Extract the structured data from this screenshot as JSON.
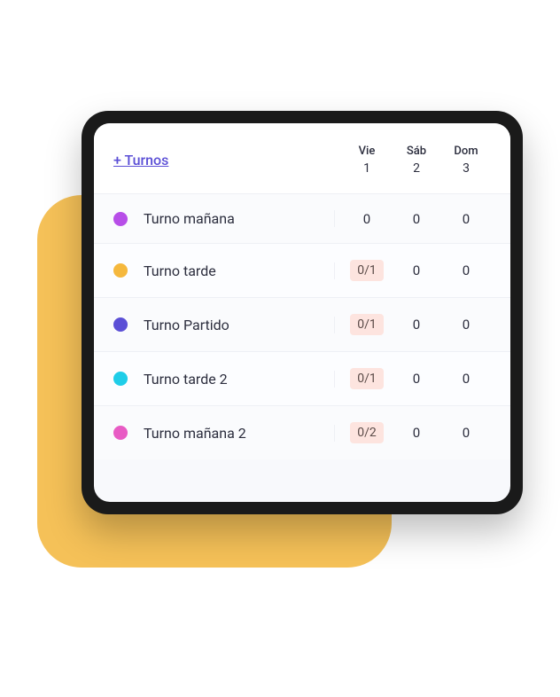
{
  "header": {
    "add_label": "+ Turnos",
    "days": [
      {
        "name": "Vie",
        "num": "1"
      },
      {
        "name": "Sáb",
        "num": "2"
      },
      {
        "name": "Dom",
        "num": "3"
      }
    ]
  },
  "shifts": [
    {
      "color": "#b74ee8",
      "name": "Turno mañana",
      "cells": [
        {
          "value": "0",
          "highlight": false
        },
        {
          "value": "0",
          "highlight": false
        },
        {
          "value": "0",
          "highlight": false
        }
      ]
    },
    {
      "color": "#f5b83d",
      "name": "Turno tarde",
      "cells": [
        {
          "value": "0/1",
          "highlight": true
        },
        {
          "value": "0",
          "highlight": false
        },
        {
          "value": "0",
          "highlight": false
        }
      ]
    },
    {
      "color": "#5b4fd6",
      "name": "Turno Partido",
      "cells": [
        {
          "value": "0/1",
          "highlight": true
        },
        {
          "value": "0",
          "highlight": false
        },
        {
          "value": "0",
          "highlight": false
        }
      ]
    },
    {
      "color": "#1fcde8",
      "name": "Turno tarde 2",
      "cells": [
        {
          "value": "0/1",
          "highlight": true
        },
        {
          "value": "0",
          "highlight": false
        },
        {
          "value": "0",
          "highlight": false
        }
      ]
    },
    {
      "color": "#e85bc4",
      "name": "Turno mañana 2",
      "cells": [
        {
          "value": "0/2",
          "highlight": true
        },
        {
          "value": "0",
          "highlight": false
        },
        {
          "value": "0",
          "highlight": false
        }
      ]
    }
  ]
}
